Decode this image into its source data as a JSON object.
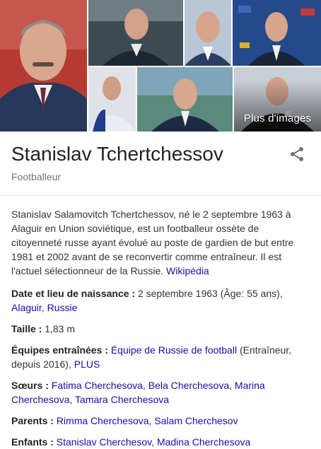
{
  "gallery": {
    "more_images_label": "Plus d'images"
  },
  "entity": {
    "name": "Stanislav Tchertchessov",
    "subtitle": "Footballeur"
  },
  "description": {
    "text": "Stanislav Salamovitch Tchertchessov, né le 2 septembre 1963 à Alaguir en Union soviétique, est un footballeur ossète de citoyenneté russe ayant évolué au poste de gardien de but entre 1981 et 2002 avant de se reconvertir comme entraîneur. Il est l'actuel sélectionneur de la Russie.",
    "source_link": "Wikipédia"
  },
  "facts": {
    "birth": {
      "label": "Date et lieu de naissance :",
      "value": "2 septembre 1963 (Âge: 55 ans),",
      "place_1": "Alaguir",
      "separator": ",",
      "place_2": "Russie"
    },
    "height": {
      "label": "Taille :",
      "value": "1,83 m"
    },
    "teams": {
      "label": "Équipes entraînées :",
      "team_link": "Équipe de Russie de football",
      "team_note": "(Entraîneur, depuis 2016),",
      "more_link": "PLUS"
    },
    "sisters": {
      "label": "Sœurs :",
      "names": [
        "Fatima Cherchesova",
        "Bela Cherchesova",
        "Marina Cherchesova",
        "Tamara Cherchesova"
      ]
    },
    "parents": {
      "label": "Parents :",
      "names": [
        "Rimma Cherchesova",
        "Salam Cherchesov"
      ]
    },
    "children": {
      "label": "Enfants :",
      "names": [
        "Stanislav Cherchesov",
        "Madina Cherchesova"
      ]
    }
  },
  "icons": {
    "share": "share-icon"
  },
  "colors": {
    "link": "#1a0dab",
    "subtitle": "#70757a",
    "divider": "#e4e4e4"
  }
}
